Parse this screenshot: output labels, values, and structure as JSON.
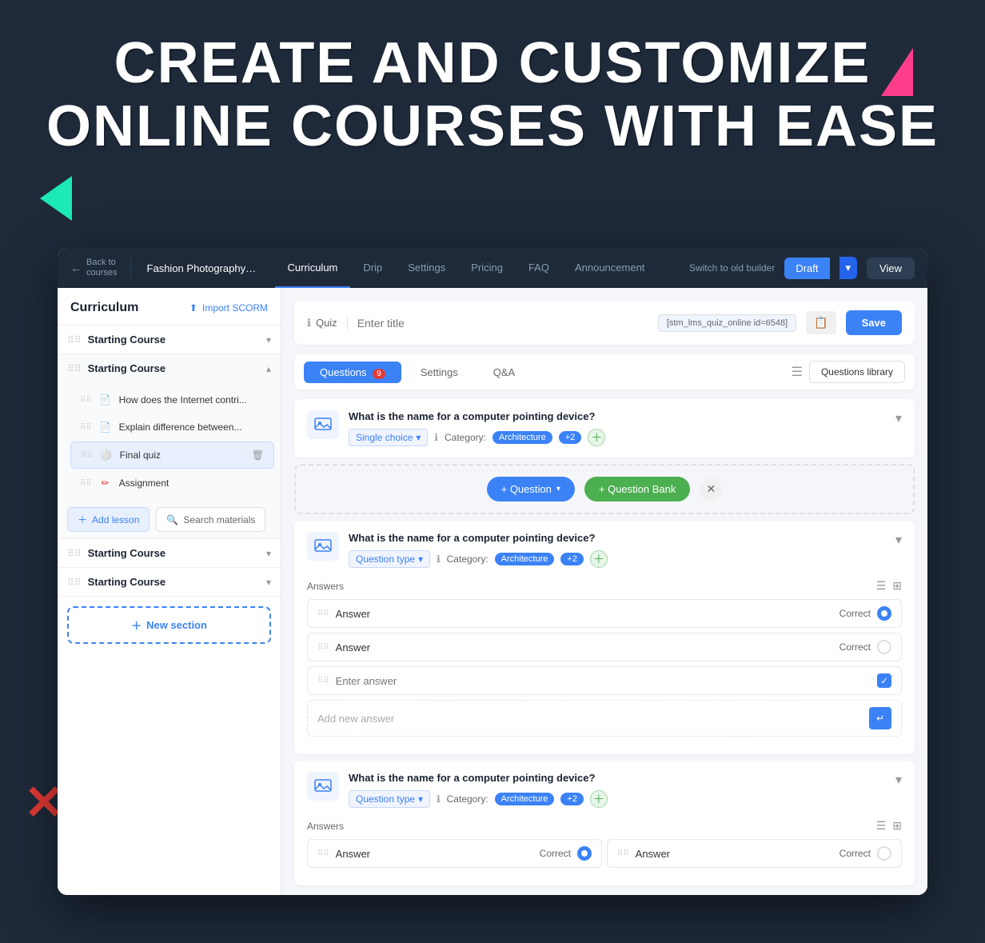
{
  "hero": {
    "line1": "CREATE AND CUSTOMIZE",
    "line2": "ONLINE COURSES WITH EASE"
  },
  "topnav": {
    "back_label": "Back to\ncourses",
    "course_title": "Fashion Photography from...",
    "tabs": [
      {
        "label": "Curriculum",
        "active": true
      },
      {
        "label": "Drip",
        "active": false
      },
      {
        "label": "Settings",
        "active": false
      },
      {
        "label": "Pricing",
        "active": false
      },
      {
        "label": "FAQ",
        "active": false
      },
      {
        "label": "Announcement",
        "active": false
      }
    ],
    "switch_old": "Switch to old builder",
    "draft_label": "Draft",
    "view_label": "View"
  },
  "sidebar": {
    "title": "Curriculum",
    "import_scorm": "Import SCORM",
    "sections": [
      {
        "name": "Starting Course",
        "expanded": false,
        "lessons": []
      },
      {
        "name": "Starting Course",
        "expanded": true,
        "lessons": [
          {
            "name": "How does the Internet contri...",
            "type": "doc"
          },
          {
            "name": "Explain difference between...",
            "type": "doc"
          },
          {
            "name": "Final quiz",
            "type": "quiz",
            "active": true
          },
          {
            "name": "Assignment",
            "type": "assign"
          }
        ]
      },
      {
        "name": "Starting Course",
        "expanded": false,
        "lessons": []
      },
      {
        "name": "Starting Course",
        "expanded": false,
        "lessons": []
      }
    ],
    "add_lesson": "Add lesson",
    "search_materials": "Search materials",
    "new_section": "New section"
  },
  "quiz": {
    "label": "Quiz",
    "title_placeholder": "Enter title",
    "shortcode": "[stm_lms_quiz_online id=6548]",
    "save_label": "Save",
    "tabs": [
      {
        "label": "Questions",
        "active": true,
        "badge": "9"
      },
      {
        "label": "Settings",
        "active": false
      },
      {
        "label": "Q&A",
        "active": false
      }
    ],
    "questions_library": "Questions library",
    "questions": [
      {
        "text": "What is the name for a computer pointing device?",
        "type": "Single choice",
        "category": "Architecture",
        "count": "+2",
        "collapsed": true
      },
      {
        "text": "What is the name for a computer pointing device?",
        "type": "Question type",
        "category": "Architecture",
        "count": "+2",
        "collapsed": false,
        "answers": [
          {
            "text": "Answer",
            "correct": true,
            "radio": true
          },
          {
            "text": "Answer",
            "correct": false,
            "radio": true
          }
        ],
        "enter_answer": "Enter answer",
        "add_new_answer": "Add new answer"
      },
      {
        "text": "What is the name for a computer pointing device?",
        "type": "Question type",
        "category": "Architecture",
        "count": "+2",
        "collapsed": false,
        "answers_grid": [
          {
            "text": "Answer",
            "correct": true
          },
          {
            "text": "Answer",
            "correct": false
          }
        ]
      }
    ],
    "add_question_label": "+ Question",
    "add_bank_label": "+ Question Bank",
    "answers_label": "Answers",
    "correct_label": "Correct"
  }
}
